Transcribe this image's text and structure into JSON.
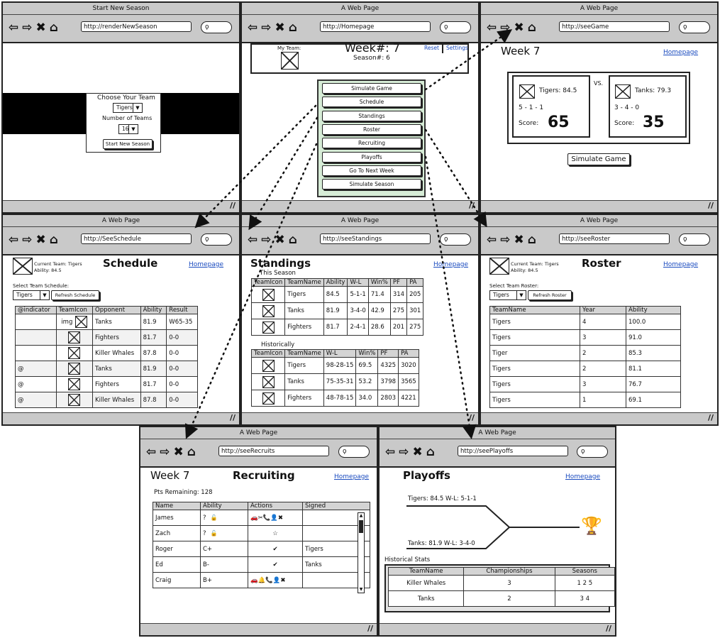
{
  "nav_icons": "⇦⇨✖⌂",
  "search_glyph": "ϙ",
  "resize_glyph": "//",
  "windows": {
    "start": {
      "title": "Start New Season",
      "url": "http://renderNewSeason",
      "choose_team_label": "Choose Your Team",
      "team_select": "Tigers",
      "number_teams_label": "Number of Teams",
      "teams_select": "16",
      "start_button": "Start New Season"
    },
    "home": {
      "title": "A Web Page",
      "url": "http://Homepage",
      "my_team_label": "My Team:",
      "week": "Week#: 7",
      "season": "Season#: 6",
      "reset": "Reset",
      "settings": "Settings",
      "menu": [
        "Simulate Game",
        "Schedule",
        "Standings",
        "Roster",
        "Recruiting",
        "Playoffs",
        "Go To Next Week",
        "Simulate Season"
      ]
    },
    "game": {
      "title": "A Web Page",
      "url": "http://seeGame",
      "week": "Week 7",
      "homepage": "Homepage",
      "vs": "VS.",
      "team1": "Tigers: 84.5",
      "rec1": "5 - 1 - 1",
      "score_label1": "Score:",
      "score1": "65",
      "team2": "Tanks: 79.3",
      "rec2": "3 - 4 - 0",
      "score_label2": "Score:",
      "score2": "35",
      "simulate_button": "Simulate Game"
    },
    "schedule": {
      "title": "A Web Page",
      "url": "http://SeeSchedule",
      "current_team": "Current Team: Tigers",
      "ability": "Ability: 84.5",
      "heading": "Schedule",
      "homepage": "Homepage",
      "select_label": "Select Team Schedule:",
      "select_value": "Tigers",
      "refresh_button": "Refresh Schedule",
      "columns": [
        "@indicator",
        "TeamIcon",
        "Opponent",
        "Ability",
        "Result"
      ],
      "rows": [
        [
          "",
          "img",
          "Tanks",
          "81.9",
          "W65-35"
        ],
        [
          "",
          "",
          "Fighters",
          "81.7",
          "0-0"
        ],
        [
          "",
          "",
          "Killer Whales",
          "87.8",
          "0-0"
        ],
        [
          "@",
          "",
          "Tanks",
          "81.9",
          "0-0"
        ],
        [
          "@",
          "",
          "Fighters",
          "81.7",
          "0-0"
        ],
        [
          "@",
          "",
          "Killer Whales",
          "87.8",
          "0-0"
        ]
      ]
    },
    "standings": {
      "title": "A Web Page",
      "url": "http://seeStandings",
      "heading": "Standings",
      "homepage": "Homepage",
      "this_season": "This Season",
      "columns": [
        "TeamIcon",
        "TeamName",
        "Ability",
        "W-L",
        "Win%",
        "PF",
        "PA"
      ],
      "rows": [
        [
          "Tigers",
          "84.5",
          "5-1-1",
          "71.4",
          "314",
          "205"
        ],
        [
          "Tanks",
          "81.9",
          "3-4-0",
          "42.9",
          "275",
          "301"
        ],
        [
          "Fighters",
          "81.7",
          "2-4-1",
          "28.6",
          "201",
          "275"
        ]
      ],
      "historically": "Historically",
      "hist_columns": [
        "TeamIcon",
        "TeamName",
        "W-L",
        "Win%",
        "PF",
        "PA"
      ],
      "hist_rows": [
        [
          "Tigers",
          "98-28-15",
          "69.5",
          "4325",
          "3020"
        ],
        [
          "Tanks",
          "75-35-31",
          "53.2",
          "3798",
          "3565"
        ],
        [
          "Fighters",
          "48-78-15",
          "34.0",
          "2803",
          "4221"
        ]
      ]
    },
    "roster": {
      "title": "A Web Page",
      "url": "http://seeRoster",
      "current_team": "Current Team: Tigers",
      "ability": "Ability: 84.5",
      "heading": "Roster",
      "homepage": "Homepage",
      "select_label": "Select Team Roster:",
      "select_value": "Tigers",
      "refresh_button": "Refresh Roster",
      "columns": [
        "TeamName",
        "Year",
        "Ability"
      ],
      "rows": [
        [
          "Tigers",
          "4",
          "100.0"
        ],
        [
          "Tigers",
          "3",
          "91.0"
        ],
        [
          "Tiger",
          "2",
          "85.3"
        ],
        [
          "Tigers",
          "2",
          "81.1"
        ],
        [
          "Tigers",
          "3",
          "76.7"
        ],
        [
          "Tigers",
          "1",
          "69.1"
        ]
      ]
    },
    "recruits": {
      "title": "A Web Page",
      "url": "http://seeRecruits",
      "week": "Week 7",
      "heading": "Recruiting",
      "homepage": "Homepage",
      "pts": "Pts Remaining: 128",
      "columns": [
        "Name",
        "Ability",
        "Actions",
        "Signed"
      ],
      "rows": [
        [
          "James",
          "?",
          "🚗✂📞👤✖",
          ""
        ],
        [
          "Zach",
          "?",
          "☆",
          ""
        ],
        [
          "Roger",
          "C+",
          "✔",
          "Tigers"
        ],
        [
          "Ed",
          "B-",
          "✔",
          "Tanks"
        ],
        [
          "Craig",
          "B+",
          "🚗🔔📞👤✖",
          ""
        ]
      ],
      "lock_glyph": "🔓"
    },
    "playoffs": {
      "title": "A Web Page",
      "url": "http://seePlayoffs",
      "heading": "Playoffs",
      "homepage": "Homepage",
      "seed1": "Tigers: 84.5 W-L: 5-1-1",
      "seed2": "Tanks: 81.9 W-L: 3-4-0",
      "trophy": "🏆",
      "hist_label": "Historical Stats",
      "columns": [
        "TeamName",
        "Championships",
        "Seasons"
      ],
      "rows": [
        [
          "Killer Whales",
          "3",
          "1 2 5"
        ],
        [
          "Tanks",
          "2",
          "3 4"
        ]
      ]
    }
  }
}
